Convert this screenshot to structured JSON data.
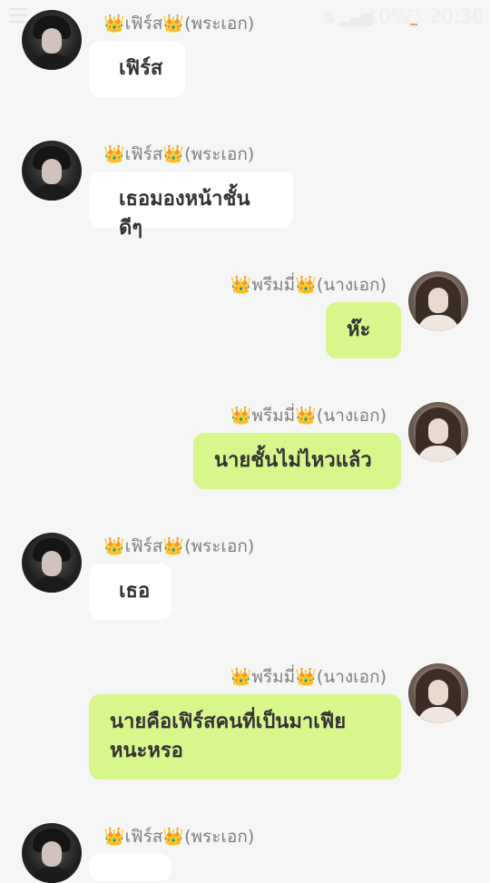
{
  "status_bar": {
    "battery_text": "10%",
    "time": "20:30",
    "signal_glyph": "⇅ ▂▄▆",
    "accent_color": "#f39a5a"
  },
  "characters": {
    "hero": {
      "name": "👑เฟิร์ส👑(พระเอก)",
      "avatar": "male-portrait-icon"
    },
    "heroine": {
      "name": "👑พรีมมี่👑(นางเอก)",
      "avatar": "female-portrait-icon"
    }
  },
  "messages": [
    {
      "side": "left",
      "sender": "👑เฟิร์ส👑(พระเอก)",
      "text": "เฟิร์ส"
    },
    {
      "side": "left",
      "sender": "👑เฟิร์ส👑(พระเอก)",
      "text": "เธอมองหน้าชั้นดีๆ"
    },
    {
      "side": "right",
      "sender": "👑พรีมมี่👑(นางเอก)",
      "text": "ห๊ะ"
    },
    {
      "side": "right",
      "sender": "👑พรีมมี่👑(นางเอก)",
      "text": "นายชั้นไม่ไหวแล้ว"
    },
    {
      "side": "left",
      "sender": "👑เฟิร์ส👑(พระเอก)",
      "text": "เธอ"
    },
    {
      "side": "right",
      "sender": "👑พรีมมี่👑(นางเอก)",
      "text": "นายคือเฟิร์สคนที่เป็นมาเฟียหนะหรอ"
    },
    {
      "side": "left",
      "sender": "👑เฟิร์ส👑(พระเอก)",
      "text": ""
    }
  ],
  "colors": {
    "background": "#f6f6f6",
    "left_bubble": "#ffffff",
    "right_bubble": "#d7f68c",
    "name_text": "#7f7f7f"
  }
}
